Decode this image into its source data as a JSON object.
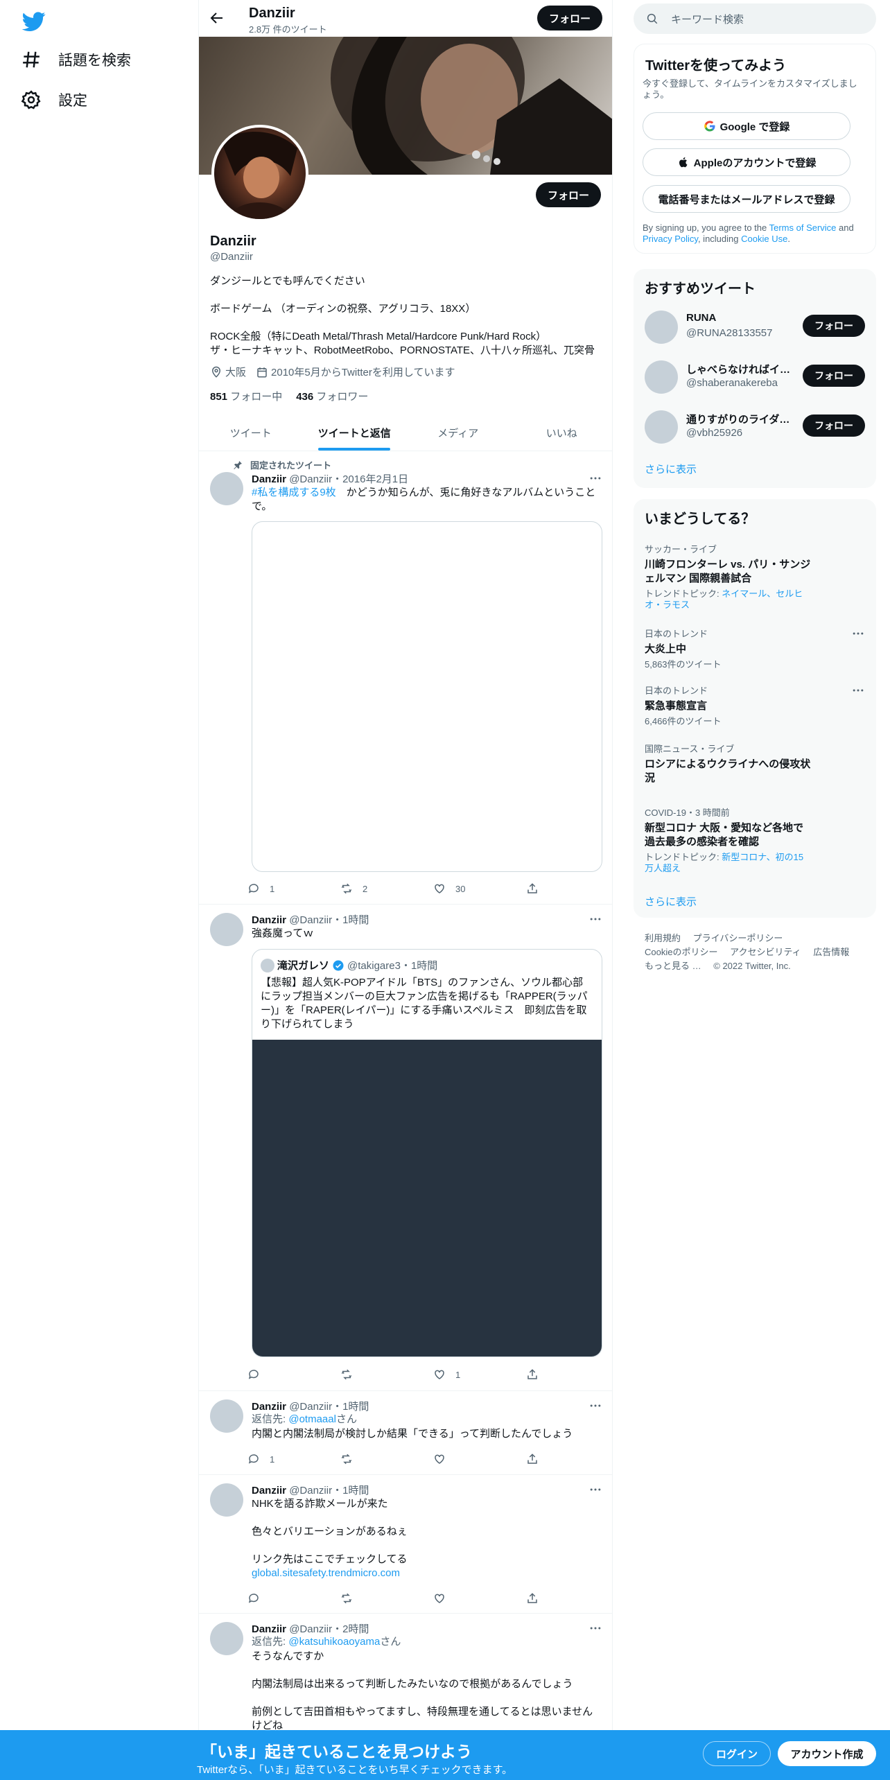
{
  "nav": {
    "explore": "話題を検索",
    "settings": "設定"
  },
  "header": {
    "name": "Danziir",
    "tweet_count": "2.8万 件のツイート",
    "follow": "フォロー"
  },
  "profile": {
    "name": "Danziir",
    "handle": "@Danziir",
    "follow": "フォロー",
    "bio": [
      "ダンジールとでも呼んでください",
      "ボードゲーム （オーディンの祝祭、アグリコラ、18XX）",
      "ROCK全般（特にDeath Metal/Thrash Metal/Hardcore Punk/Hard Rock）",
      "ザ・ヒーナキャット、RobotMeetRobo、PORNOSTATE、八十八ヶ所巡礼、兀突骨"
    ],
    "location": "大阪",
    "joined": "2010年5月からTwitterを利用しています",
    "following_count": "851",
    "following_label": "フォロー中",
    "followers_count": "436",
    "followers_label": "フォロワー"
  },
  "tabs": [
    "ツイート",
    "ツイートと返信",
    "メディア",
    "いいね"
  ],
  "tweets": [
    {
      "pinned_label": "固定されたツイート",
      "name": "Danziir",
      "meta": "@Danziir・2016年2月1日",
      "hashtag": "#私を構成する9枚",
      "text": "　かどうか知らんが、兎に角好きなアルバムということで。",
      "replies": "1",
      "retweets": "2",
      "likes": "30"
    },
    {
      "name": "Danziir",
      "meta": "@Danziir・1時間",
      "text": "強姦魔ってｗ",
      "quote_name": "滝沢ガレソ",
      "quote_meta": "@takigare3・1時間",
      "quote_text": "【悲報】超人気K-POPアイドル「BTS」のファンさん、ソウル都心部にラップ担当メンバーの巨大ファン広告を掲げるも「RAPPER(ラッパー)」を「RAPER(レイパー)」にする手痛いスペルミス　即刻広告を取り下げられてしまう",
      "replies": "",
      "retweets": "",
      "likes": "1"
    },
    {
      "name": "Danziir",
      "meta": "@Danziir・1時間",
      "reply_prefix": "返信先: ",
      "reply_to": "@otmaaal",
      "reply_suffix": "さん",
      "text": "内閣と内閣法制局が検討しか結果「できる」って判断したんでしょう",
      "replies": "1",
      "retweets": "",
      "likes": ""
    },
    {
      "name": "Danziir",
      "meta": "@Danziir・1時間",
      "line1": "NHKを語る詐欺メールが来た",
      "line2": "色々とバリエーションがあるねぇ",
      "line3": "リンク先はここでチェックしてる",
      "link": "global.sitesafety.trendmicro.com"
    },
    {
      "name": "Danziir",
      "meta": "@Danziir・2時間",
      "reply_prefix": "返信先: ",
      "reply_to": "@katsuhikoaoyama",
      "reply_suffix": "さん",
      "line1": "そうなんですか",
      "line2": "内閣法制局は出来るって判断したみたいなので根拠があるんでしょう",
      "line3": "前例として吉田首相もやってますし、特段無理を通してるとは思いませんけどね"
    }
  ],
  "search": {
    "placeholder": "キーワード検索"
  },
  "signup_card": {
    "title": "Twitterを使ってみよう",
    "subtitle": "今すぐ登録して、タイムラインをカスタマイズしましょう。",
    "google": "Google で登録",
    "apple": "Appleのアカウントで登録",
    "phone": "電話番号またはメールアドレスで登録",
    "terms_prefix": "By signing up, you agree to the ",
    "terms": "Terms of Service",
    "and": " and ",
    "privacy": "Privacy Policy",
    "including": ", including ",
    "cookie": "Cookie Use",
    "period": "."
  },
  "recommend": {
    "title": "おすすめツイート",
    "follow": "フォロー",
    "users": [
      {
        "name": "RUNA",
        "handle": "@RUNA28133557"
      },
      {
        "name": "しゃべらなければイ…",
        "handle": "@shaberanakereba"
      },
      {
        "name": "通りすがりのライダー…",
        "handle": "@vbh25926"
      }
    ],
    "more": "さらに表示"
  },
  "trends": {
    "title": "いまどうしてる？",
    "items": [
      {
        "category": "サッカー・ライブ",
        "title": "川崎フロンターレ vs. パリ・サンジェルマン 国際親善試合",
        "sub_label": "トレンドトピック: ",
        "sub_links": "ネイマール、セルヒオ・ラモス"
      },
      {
        "category": "日本のトレンド",
        "title": "大炎上中",
        "count": "5,863件のツイート"
      },
      {
        "category": "日本のトレンド",
        "title": "緊急事態宣言",
        "count": "6,466件のツイート"
      },
      {
        "category": "国際ニュース・ライブ",
        "title": "ロシアによるウクライナへの侵攻状況"
      },
      {
        "category": "COVID-19・3 時間前",
        "title": "新型コロナ 大阪・愛知など各地で過去最多の感染者を確認",
        "sub_label": "トレンドトピック: ",
        "sub_links": "新型コロナ、初の15万人超え"
      }
    ],
    "more": "さらに表示"
  },
  "footer": {
    "terms": "利用規約",
    "privacy": "プライバシーポリシー",
    "cookie": "Cookieのポリシー",
    "accessibility": "アクセシビリティ",
    "ads": "広告情報",
    "more": "もっと見る …",
    "copyright": "© 2022 Twitter, Inc."
  },
  "bottom_bar": {
    "headline": "「いま」起きていることを見つけよう",
    "sub": "Twitterなら、「いま」起きていることをいち早くチェックできます。",
    "login": "ログイン",
    "signup": "アカウント作成"
  },
  "colors": {
    "accent": "#1d9bf0",
    "dark": "#0f1419",
    "muted": "#536471"
  }
}
